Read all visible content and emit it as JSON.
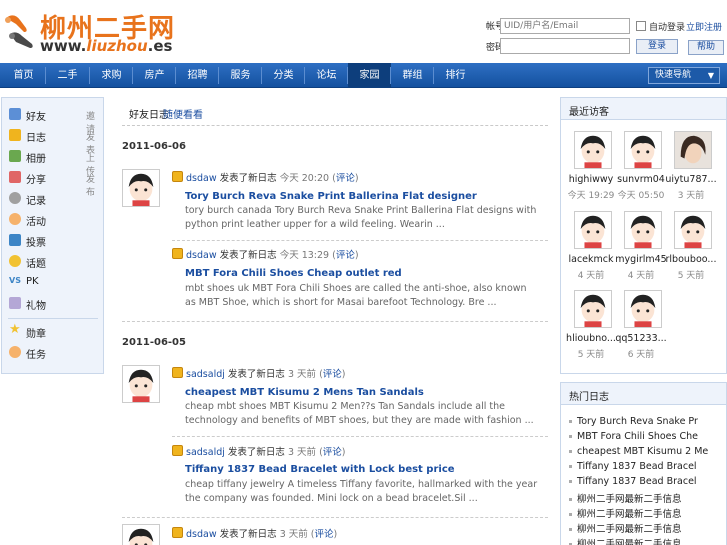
{
  "logo": {
    "title": "柳州二手网",
    "url_prefix": "www.",
    "url_brand": "liuzhou",
    "url_suffix": ".es"
  },
  "login": {
    "user_label": "帐号",
    "user_placeholder": "UID/用户名/Email",
    "remember_label": "自动登录",
    "register_link": "立即注册",
    "pass_label": "密码",
    "login_button": "登录",
    "help_button": "帮助"
  },
  "nav": {
    "items": [
      "首页",
      "二手",
      "求购",
      "房产",
      "招聘",
      "服务",
      "分类",
      "论坛",
      "家园",
      "群组",
      "排行"
    ],
    "active_index": 8,
    "select_label": "快速导航"
  },
  "sidebar": {
    "items": [
      {
        "label": "好友",
        "extra": "邀请",
        "color": "#5c8fd6"
      },
      {
        "label": "日志",
        "extra": "发表",
        "color": "#f0b41e"
      },
      {
        "label": "相册",
        "extra": "上传",
        "color": "#6aa84f"
      },
      {
        "label": "分享",
        "extra": "发布",
        "color": "#e06666"
      },
      {
        "label": "记录",
        "extra": "",
        "color": "#a0a0a0"
      },
      {
        "label": "活动",
        "extra": "",
        "color": "#f6b26b"
      },
      {
        "label": "投票",
        "extra": "",
        "color": "#3d85c6"
      },
      {
        "label": "话题",
        "extra": "",
        "color": "#f1c232"
      },
      {
        "label": "PK",
        "extra": "",
        "color": "#3d85c6"
      },
      {
        "label": "礼物",
        "extra": "",
        "color": "#b4a7d6"
      },
      {
        "label": "勋章",
        "extra": "",
        "color": "#f1c232"
      },
      {
        "label": "任务",
        "extra": "",
        "color": "#f6b26b"
      }
    ]
  },
  "tabs": {
    "first": "好友日志",
    "second": "随便看看"
  },
  "feed": {
    "days": [
      {
        "date": "2011-06-06",
        "entries": [
          {
            "user": "dsdaw",
            "action": "发表了新日志",
            "time": "今天 20:20",
            "link": "评论",
            "title": "Tory Burch Reva Snake Print Ballerina Flat designer",
            "desc": "tory burch canada Tory Burch Reva Snake Print Ballerina Flat designs with python print leather upper for a wild feeling. Wearin ..."
          },
          {
            "user": "dsdaw",
            "action": "发表了新日志",
            "time": "今天 13:29",
            "link": "评论",
            "title": "MBT Fora Chili Shoes Cheap outlet red",
            "desc": "mbt shoes uk MBT Fora Chili Shoes are called the anti-shoe, also known as MBT Shoe, which is short for Masai barefoot Technology. Bre ..."
          }
        ]
      },
      {
        "date": "2011-06-05",
        "entries": [
          {
            "user": "sadsaldj",
            "action": "发表了新日志",
            "time": "3 天前",
            "link": "评论",
            "title": "cheapest MBT Kisumu 2 Mens Tan Sandals",
            "desc": "cheap mbt shoes MBT Kisumu 2 Men??s Tan Sandals include all the technology and benefits of MBT shoes, but they are made with fashion ..."
          },
          {
            "user": "sadsaldj",
            "action": "发表了新日志",
            "time": "3 天前",
            "link": "评论",
            "title": "Tiffany 1837 Bead Bracelet with Lock best price",
            "desc": "cheap tiffany jewelry A timeless Tiffany favorite, hallmarked with the year the company was founded. Mini lock on a bead bracelet.Sil ..."
          },
          {
            "user": "dsdaw",
            "action": "发表了新日志",
            "time": "3 天前",
            "link": "评论",
            "title": "",
            "desc": ""
          }
        ]
      }
    ]
  },
  "visitors": {
    "title": "最近访客",
    "items": [
      {
        "name": "highiwwy",
        "time": "今天 19:29"
      },
      {
        "name": "sunvrm04",
        "time": "今天 05:50"
      },
      {
        "name": "uiytu787...",
        "time": "3 天前"
      },
      {
        "name": "lacekmck",
        "time": "4 天前"
      },
      {
        "name": "mygirlm45",
        "time": "4 天前"
      },
      {
        "name": "rlbouboo...",
        "time": "5 天前"
      },
      {
        "name": "hlioubno...",
        "time": "5 天前"
      },
      {
        "name": "qq51233...",
        "time": "6 天前"
      }
    ]
  },
  "hot": {
    "title": "热门日志",
    "items": [
      "Tory Burch Reva Snake Pr",
      "MBT Fora Chili Shoes Che",
      "cheapest MBT Kisumu 2 Me",
      "Tiffany 1837 Bead Bracel",
      "Tiffany 1837 Bead Bracel",
      "柳州二手网最新二手信息",
      "柳州二手网最新二手信息",
      "柳州二手网最新二手信息",
      "柳州二手网最新二手信息"
    ]
  }
}
